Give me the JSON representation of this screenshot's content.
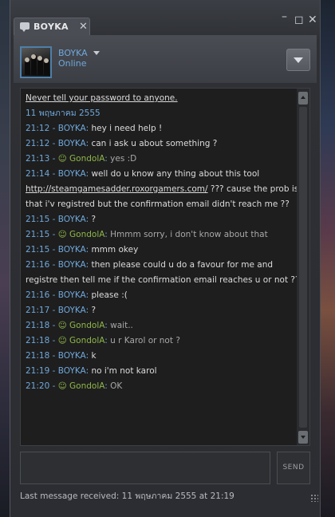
{
  "window": {
    "tab_title": "BOYKA",
    "tab_close": "✕",
    "minimize": "–",
    "maximize": "◻",
    "close": "✕"
  },
  "header": {
    "friend_name": "BOYKA",
    "friend_status": "Online"
  },
  "chat": {
    "warning": "Never tell your password to anyone.",
    "date": "11 พฤษภาคม 2555",
    "messages": [
      {
        "time": "21:12",
        "sender": "BOYKA",
        "text": "hey i need help !",
        "type": "self"
      },
      {
        "time": "21:12",
        "sender": "BOYKA",
        "text": "can i ask u about something ?",
        "type": "self"
      },
      {
        "time": "21:13",
        "sender": "GondolA",
        "text": "yes :D",
        "type": "friend"
      },
      {
        "time": "21:14",
        "sender": "BOYKA",
        "text": "well do u know any thing about this tool",
        "type": "self"
      },
      {
        "link": "http://steamgamesadder.roxorgamers.com/",
        "text": " ??? cause the prob is",
        "type": "cont-link"
      },
      {
        "text": "that i'v registred but the confirmation email didn't reach me ??",
        "type": "cont"
      },
      {
        "time": "21:15",
        "sender": "BOYKA",
        "text": "?",
        "type": "self"
      },
      {
        "time": "21:15",
        "sender": "GondolA",
        "text": "Hmmm sorry, i don't know about that",
        "type": "friend"
      },
      {
        "time": "21:15",
        "sender": "BOYKA",
        "text": "mmm okey",
        "type": "self"
      },
      {
        "time": "21:16",
        "sender": "BOYKA",
        "text": "then please could u do a favour for me and",
        "type": "self"
      },
      {
        "text": "registre then tell me if the confirmation email reaches u or not ??",
        "type": "cont"
      },
      {
        "time": "21:16",
        "sender": "BOYKA",
        "text": "please :(",
        "type": "self"
      },
      {
        "time": "21:17",
        "sender": "BOYKA",
        "text": "?",
        "type": "self"
      },
      {
        "time": "21:18",
        "sender": "GondolA",
        "text": "wait..",
        "type": "friend"
      },
      {
        "time": "21:18",
        "sender": "GondolA",
        "text": "u r Karol or not ?",
        "type": "friend"
      },
      {
        "time": "21:18",
        "sender": "BOYKA",
        "text": "k",
        "type": "self"
      },
      {
        "time": "21:19",
        "sender": "BOYKA",
        "text": "no i'm not karol",
        "type": "self"
      },
      {
        "time": "21:20",
        "sender": "GondolA",
        "text": "OK",
        "type": "friend"
      }
    ]
  },
  "composer": {
    "value": "",
    "send_label": "SEND"
  },
  "footer": {
    "last_message": "Last message received: 11 พฤษภาคม 2555 at 21:19"
  },
  "colors": {
    "accent_blue": "#6fa8dc",
    "friend_green": "#8fb74a",
    "background": "#2b2d32"
  },
  "icons": {
    "tab": "chat-bubble-icon",
    "friend_icon": "smiley-icon",
    "dropdown": "chevron-down-icon"
  }
}
